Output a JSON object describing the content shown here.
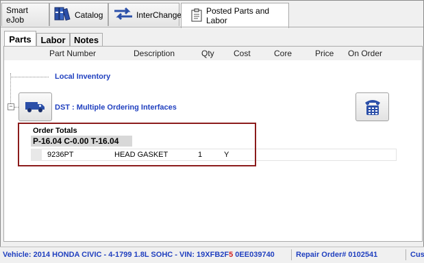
{
  "toolbar": {
    "tabs": [
      {
        "label": "Smart eJob"
      },
      {
        "label": "Catalog",
        "icon": "catalog-books-icon"
      },
      {
        "label": "InterChange",
        "icon": "interchange-arrows-icon"
      },
      {
        "label": "Posted Parts and Labor",
        "icon": "clipboard-icon"
      }
    ]
  },
  "inner_tabs": [
    {
      "label": "Parts"
    },
    {
      "label": "Labor"
    },
    {
      "label": "Notes"
    }
  ],
  "grid": {
    "columns": [
      "Part Number",
      "Description",
      "Qty",
      "Cost",
      "Core",
      "Price",
      "On Order"
    ]
  },
  "tree": {
    "local_inventory": "Local Inventory",
    "dst_label": "DST : Multiple Ordering Interfaces",
    "expander": "−"
  },
  "order": {
    "title": "Order Totals",
    "totals": "P-16.04 C-0.00 T-16.04",
    "row": {
      "part_number": "9236PT",
      "description": "HEAD GASKET",
      "qty": "1",
      "on_order": "Y"
    }
  },
  "status": {
    "vehicle_prefix": "Vehicle: 2014 HONDA CIVIC - 4-1799 1.8L SOHC - VIN: 19XFB2F",
    "vin_highlight": "5",
    "vin_suffix": " 0EE039740",
    "repair_order": "Repair Order# 0102541",
    "customer": "Custo"
  },
  "colors": {
    "link_blue": "#1f3fbf",
    "highlight_red": "#8b1a1a",
    "vin_red": "#d02020"
  }
}
